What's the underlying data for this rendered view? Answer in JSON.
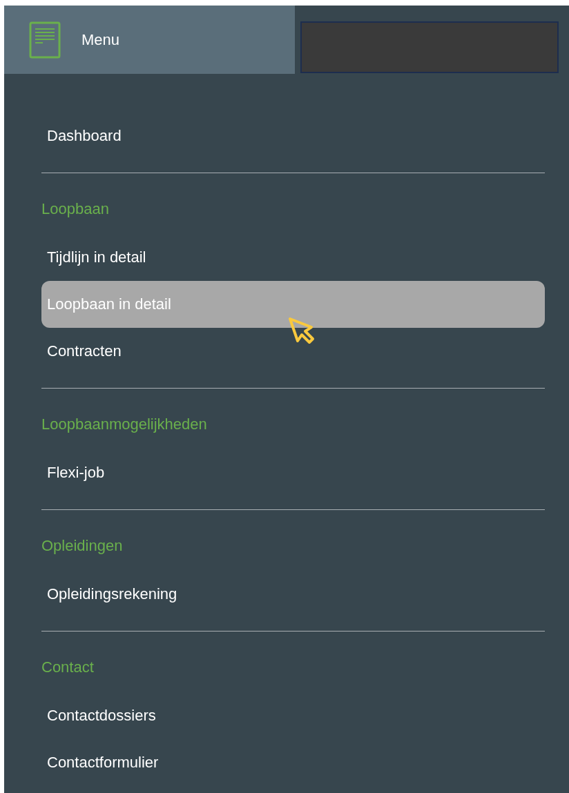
{
  "header": {
    "title": "Menu"
  },
  "sections": [
    {
      "items": [
        {
          "label": "Dashboard",
          "selected": false
        }
      ]
    },
    {
      "heading": "Loopbaan",
      "items": [
        {
          "label": "Tijdlijn in detail",
          "selected": false
        },
        {
          "label": "Loopbaan in detail",
          "selected": true
        },
        {
          "label": "Contracten",
          "selected": false
        }
      ]
    },
    {
      "heading": "Loopbaanmogelijkheden",
      "items": [
        {
          "label": "Flexi-job",
          "selected": false
        }
      ]
    },
    {
      "heading": "Opleidingen",
      "items": [
        {
          "label": "Opleidingsrekening",
          "selected": false
        }
      ]
    },
    {
      "heading": "Contact",
      "items": [
        {
          "label": "Contactdossiers",
          "selected": false
        },
        {
          "label": "Contactformulier",
          "selected": false
        }
      ]
    }
  ]
}
